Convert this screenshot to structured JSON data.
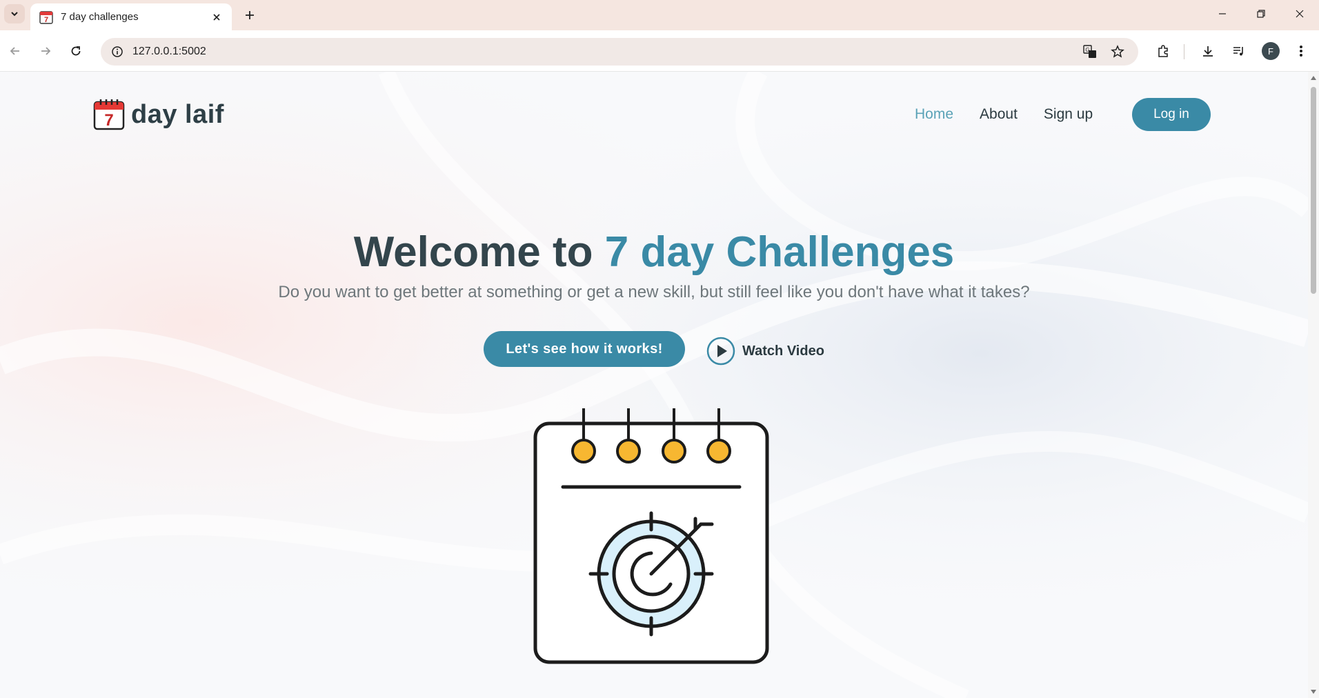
{
  "browser": {
    "tab_title": "7 day challenges",
    "url": "127.0.0.1:5002",
    "profile_initial": "F"
  },
  "site": {
    "logo_digit": "7",
    "logo_text": "day laif",
    "nav": [
      {
        "label": "Home",
        "active": true
      },
      {
        "label": "About",
        "active": false
      },
      {
        "label": "Sign up",
        "active": false
      }
    ],
    "login_label": "Log in"
  },
  "hero": {
    "title_prefix": "Welcome to ",
    "title_accent": "7 day Challenges",
    "subtitle": "Do you want to get better at something or get a new skill, but still feel like you don't have what it takes?",
    "cta_label": "Let's see how it works!",
    "video_label": "Watch Video"
  },
  "colors": {
    "accent": "#3a8aa6",
    "accent_light": "#5aa2b7",
    "heading": "#33454c",
    "ring_yellow": "#f7b731",
    "target_fill": "#d9f0fb"
  }
}
